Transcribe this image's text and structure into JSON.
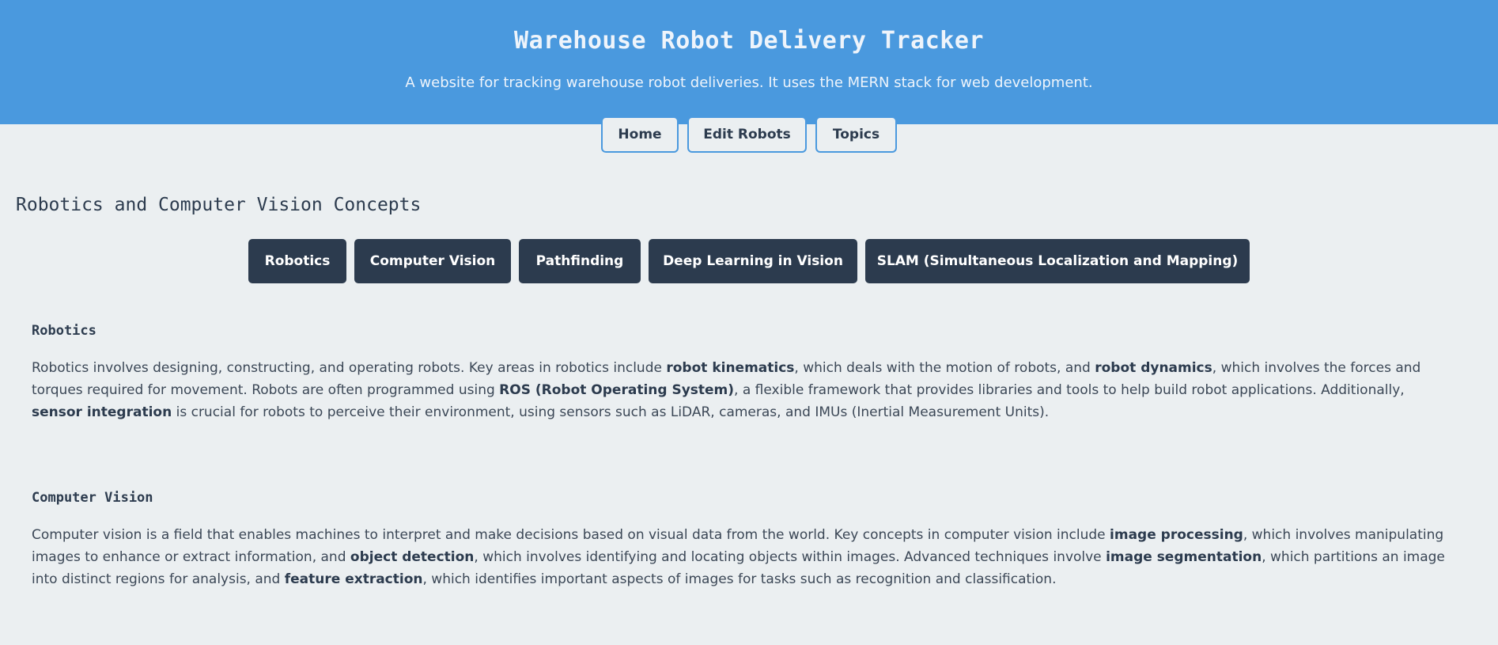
{
  "header": {
    "title": "Warehouse Robot Delivery Tracker",
    "subtitle": "A website for tracking warehouse robot deliveries. It uses the MERN stack for web development."
  },
  "nav": {
    "items": [
      {
        "label": "Home"
      },
      {
        "label": "Edit Robots"
      },
      {
        "label": "Topics"
      }
    ]
  },
  "main": {
    "title": "Robotics and Computer Vision Concepts",
    "topic_buttons": [
      {
        "label": "Robotics"
      },
      {
        "label": "Computer Vision"
      },
      {
        "label": "Pathfinding"
      },
      {
        "label": "Deep Learning in Vision"
      },
      {
        "label": "SLAM (Simultaneous Localization and Mapping)"
      }
    ],
    "sections": [
      {
        "heading": "Robotics",
        "body": [
          "Robotics involves designing, constructing, and operating robots. Key areas in robotics include ",
          "robot kinematics",
          ", which deals with the motion of robots, and ",
          "robot dynamics",
          ", which involves the forces and torques required for movement. Robots are often programmed using ",
          "ROS (Robot Operating System)",
          ", a flexible framework that provides libraries and tools to help build robot applications. Additionally, ",
          "sensor integration",
          " is crucial for robots to perceive their environment, using sensors such as LiDAR, cameras, and IMUs (Inertial Measurement Units)."
        ]
      },
      {
        "heading": "Computer Vision",
        "body": [
          "Computer vision is a field that enables machines to interpret and make decisions based on visual data from the world. Key concepts in computer vision include ",
          "image processing",
          ", which involves manipulating images to enhance or extract information, and ",
          "object detection",
          ", which involves identifying and locating objects within images. Advanced techniques involve ",
          "image segmentation",
          ", which partitions an image into distinct regions for analysis, and ",
          "feature extraction",
          ", which identifies important aspects of images for tasks such as recognition and classification."
        ]
      }
    ]
  },
  "colors": {
    "header_bg": "#4a99de",
    "page_bg": "#ebeff1",
    "dark_navy": "#2c3b4e"
  }
}
